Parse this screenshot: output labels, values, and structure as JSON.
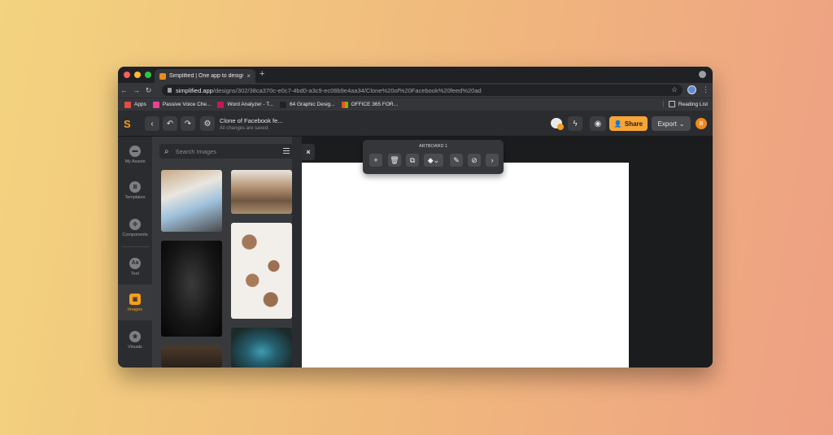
{
  "browser": {
    "tab_title": "Simplified | One app to design...",
    "tab_close": "×",
    "new_tab": "+",
    "url_host": "simplified.app",
    "url_path": "/designs/302/38ca370c-e0c7-4bd0-a3c9-ec08b9e4aa34/Clone%20of%20Facebook%20feed%20ad",
    "nav": {
      "back": "←",
      "forward": "→",
      "reload": "↻"
    },
    "star": "☆",
    "menu": "⋮",
    "bookmarks": [
      {
        "label": "Apps",
        "color": "#e74c3c"
      },
      {
        "label": "Passive Voice Che...",
        "color": "#e84393"
      },
      {
        "label": "Word Analyzer - T...",
        "color": "#e84393"
      },
      {
        "label": "64 Graphic Desig...",
        "color": "#222222"
      },
      {
        "label": "OFFICE 365 FOR...",
        "color": "#f25022"
      }
    ],
    "reading_list": "Reading List"
  },
  "app": {
    "doc_title": "Clone of Facebook fe...",
    "doc_status": "All changes are saved.",
    "back_icon": "‹",
    "undo_icon": "↶",
    "redo_icon": "↷",
    "settings_icon": "⚙",
    "bolt_icon": "ϟ",
    "preview_icon": "◉",
    "share_label": "Share",
    "export_label": "Export",
    "export_caret": "⌄",
    "user_initial": "B",
    "accent": "#f59f1a"
  },
  "rail": [
    {
      "label": "My Assets",
      "icon": "folder-icon",
      "glyph": "▬"
    },
    {
      "label": "Templates",
      "icon": "templates-icon",
      "glyph": "Ⅲ"
    },
    {
      "label": "Components",
      "icon": "components-icon",
      "glyph": "✣"
    },
    {
      "label": "Text",
      "icon": "text-icon",
      "glyph": "Aa"
    },
    {
      "label": "Images",
      "icon": "images-icon",
      "glyph": "▣"
    },
    {
      "label": "Visuals",
      "icon": "visuals-icon",
      "glyph": "❀"
    }
  ],
  "panel": {
    "search_placeholder": "Search Images",
    "search_icon": "⌕"
  },
  "canvas": {
    "close_icon": "×",
    "artboard_label": "ARTBOARD 1",
    "toolbar": [
      "+",
      "🗑",
      "⧉",
      "◆⌄",
      "✎",
      "⊘",
      "›"
    ]
  }
}
